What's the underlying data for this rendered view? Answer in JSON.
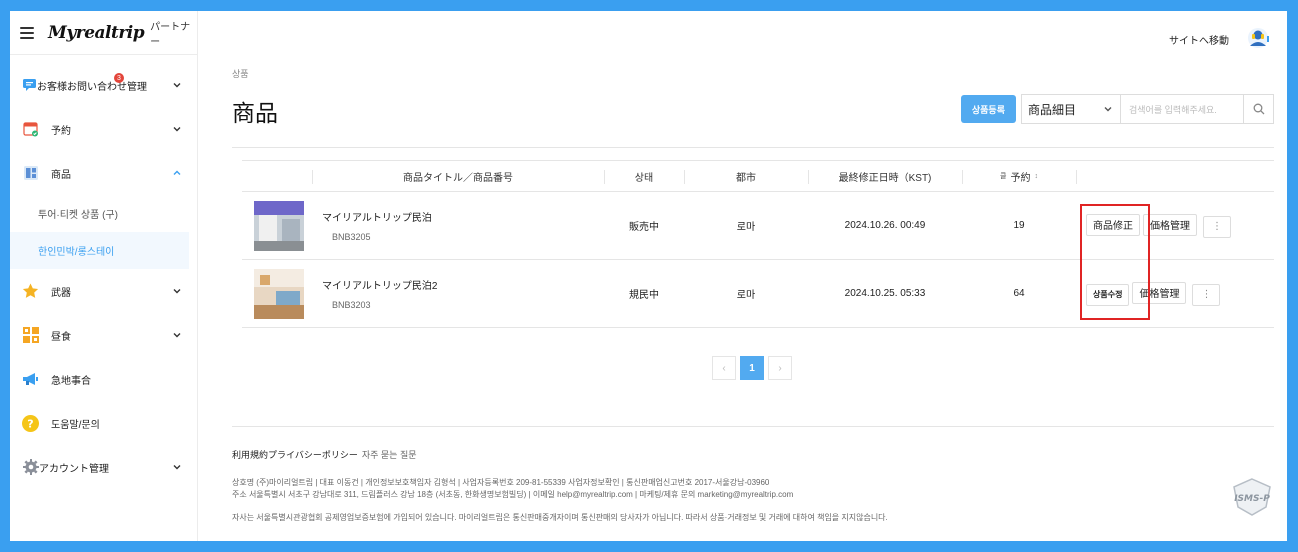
{
  "sidebar": {
    "logo": "Myrealtrip",
    "partner_label": "パートナー",
    "items": [
      {
        "label": "お客様お問い合わせ管理",
        "badge": "3",
        "icon": "chat-icon",
        "has_chevron": true
      },
      {
        "label": "予約",
        "icon": "calendar-icon",
        "has_chevron": true
      },
      {
        "label": "商品",
        "icon": "grid-icon",
        "has_chevron": true,
        "expanded": true
      },
      {
        "label": "武器",
        "icon": "star-icon",
        "has_chevron": true
      },
      {
        "label": "昼食",
        "icon": "widgets-icon",
        "has_chevron": true
      },
      {
        "label": "急地事合",
        "icon": "megaphone-icon",
        "has_chevron": false
      },
      {
        "label": "도움말/문의",
        "icon": "question-icon",
        "has_chevron": false
      },
      {
        "label": "アカウント管理",
        "icon": "gear-icon",
        "has_chevron": true
      }
    ],
    "sub_items": [
      {
        "label": "투어·티켓 상품 (구)",
        "active": false
      },
      {
        "label": "한인민박/롱스테이",
        "active": true
      }
    ]
  },
  "topbar": {
    "site_link": "サイトへ移動"
  },
  "main": {
    "breadcrumb": "상품",
    "title": "商品",
    "register_button": "상품등록",
    "select_value": "商品細目",
    "search_placeholder": "검색어를 입력해주세요."
  },
  "table": {
    "headers": {
      "title": "商品タイトル／商品番号",
      "status": "상태",
      "city": "都市",
      "updated": "最終修正日時（KST)",
      "booking_prefix": "클",
      "booking": "予約",
      "booking_suffix": "↕"
    },
    "rows": [
      {
        "name": "マイリアルトリップ民泊",
        "code": "BNB3205",
        "status": "販売中",
        "city": "로마",
        "updated": "2024.10.26. 00:49",
        "bookings": "19",
        "edit_label": "商品修正",
        "price_label": "価格管理",
        "more_label": "⋮"
      },
      {
        "name": "マイリアルトリップ民泊2",
        "code": "BNB3203",
        "status": "規民中",
        "city": "로마",
        "updated": "2024.10.25. 05:33",
        "bookings": "64",
        "edit_label": "상품수정",
        "price_label": "価格管理",
        "more_label": "⋮"
      }
    ]
  },
  "pagination": {
    "prev": "‹",
    "current": "1",
    "next": "›"
  },
  "footer": {
    "terms": "利用規約",
    "privacy": "プライバシーポリシー",
    "faq": "자주 묻는 질문",
    "biz_line1": "상호명 (주)마이리얼트립 | 대표 이동건 | 개인정보보호책임자 김형석 | 사업자등록번호 209-81-55339 사업자정보확인 | 통신판매업신고번호 2017-서울강남-03960",
    "biz_line2": "주소 서울특별시 서초구 강남대로 311, 드림플러스 강남 18층 (서초동, 한화생명보험빌딩) | 이메일 help@myrealtrip.com | 마케팅/제휴 문의 marketing@myrealtrip.com",
    "disclaimer": "자사는 서울특별시관광협회 공제영업보증보험에 가입되어 있습니다. 마이리얼트립은 통신판매중개자이며 통신판매의 당사자가 아닙니다. 따라서 상품·거래정보 및 거래에 대하여 책임을 지지않습니다.",
    "isms_label": "ISMS-P"
  },
  "colors": {
    "accent": "#52aaf0",
    "background": "#3a9ff0",
    "highlight": "#e02424"
  }
}
